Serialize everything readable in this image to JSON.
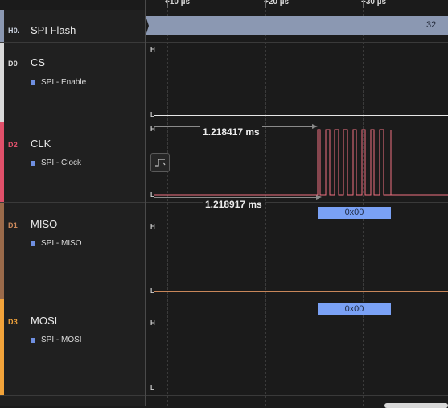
{
  "timeline": {
    "ticks": [
      "+10 µs",
      "+20 µs",
      "+30 µs"
    ]
  },
  "analyzer": {
    "code": "H0.",
    "name": "SPI Flash",
    "value": "32",
    "color": "#8b98b2"
  },
  "channels": [
    {
      "code": "D0",
      "name": "CS",
      "analyzer_label": "SPI - Enable",
      "color": "#d9d9d9",
      "code_color": "#d9d9d9",
      "trace_color": "#e6e6e6"
    },
    {
      "code": "D2",
      "name": "CLK",
      "analyzer_label": "SPI - Clock",
      "color": "#e0506a",
      "code_color": "#e0506a",
      "trace_color": "#f07080"
    },
    {
      "code": "D1",
      "name": "MISO",
      "analyzer_label": "SPI - MISO",
      "color": "#9a6a4a",
      "code_color": "#c9875a",
      "trace_color": "#c9875a"
    },
    {
      "code": "D3",
      "name": "MOSI",
      "analyzer_label": "SPI - MOSI",
      "color": "#f2a33a",
      "code_color": "#f2a33a",
      "trace_color": "#f2a33a"
    }
  ],
  "levels": {
    "high": "H",
    "low": "L"
  },
  "decoded": {
    "miso": "0x00",
    "mosi": "0x00"
  },
  "measurements": {
    "top": "1.218417 ms",
    "bottom": "1.218917 ms"
  },
  "trigger_icon": "edge-trigger-icon"
}
